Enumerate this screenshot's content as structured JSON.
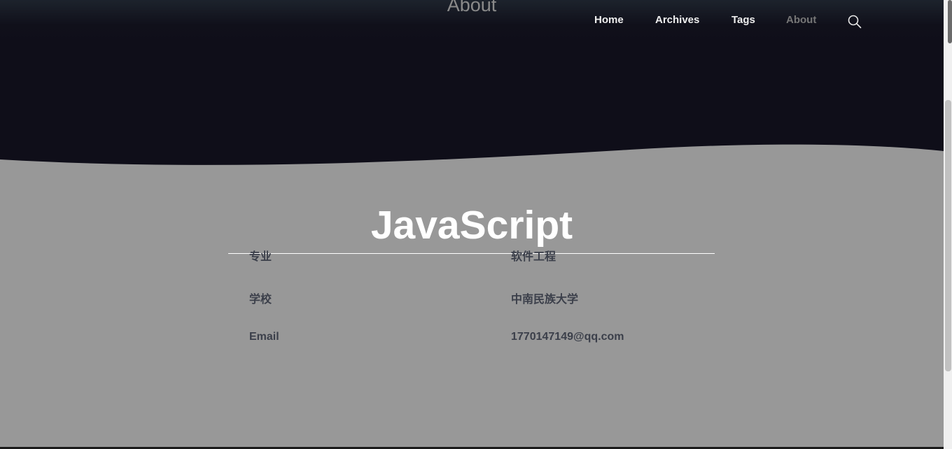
{
  "hero": {
    "title": "About"
  },
  "nav": {
    "items": [
      {
        "label": "Home",
        "active": false
      },
      {
        "label": "Archives",
        "active": false
      },
      {
        "label": "Tags",
        "active": false
      },
      {
        "label": "About",
        "active": true
      }
    ],
    "search_icon": "search-icon"
  },
  "page": {
    "title": "JavaScript"
  },
  "info": [
    {
      "label": "专业",
      "value": "软件工程"
    },
    {
      "label": "学校",
      "value": "中南民族大学"
    },
    {
      "label": "Email",
      "value": "1770147149@qq.com"
    }
  ],
  "colors": {
    "hero_bg": "#0f0e19",
    "body_bg": "#989898",
    "text": "#3b3f4a",
    "nav_text": "#eeeeee",
    "nav_active": "#767676"
  }
}
